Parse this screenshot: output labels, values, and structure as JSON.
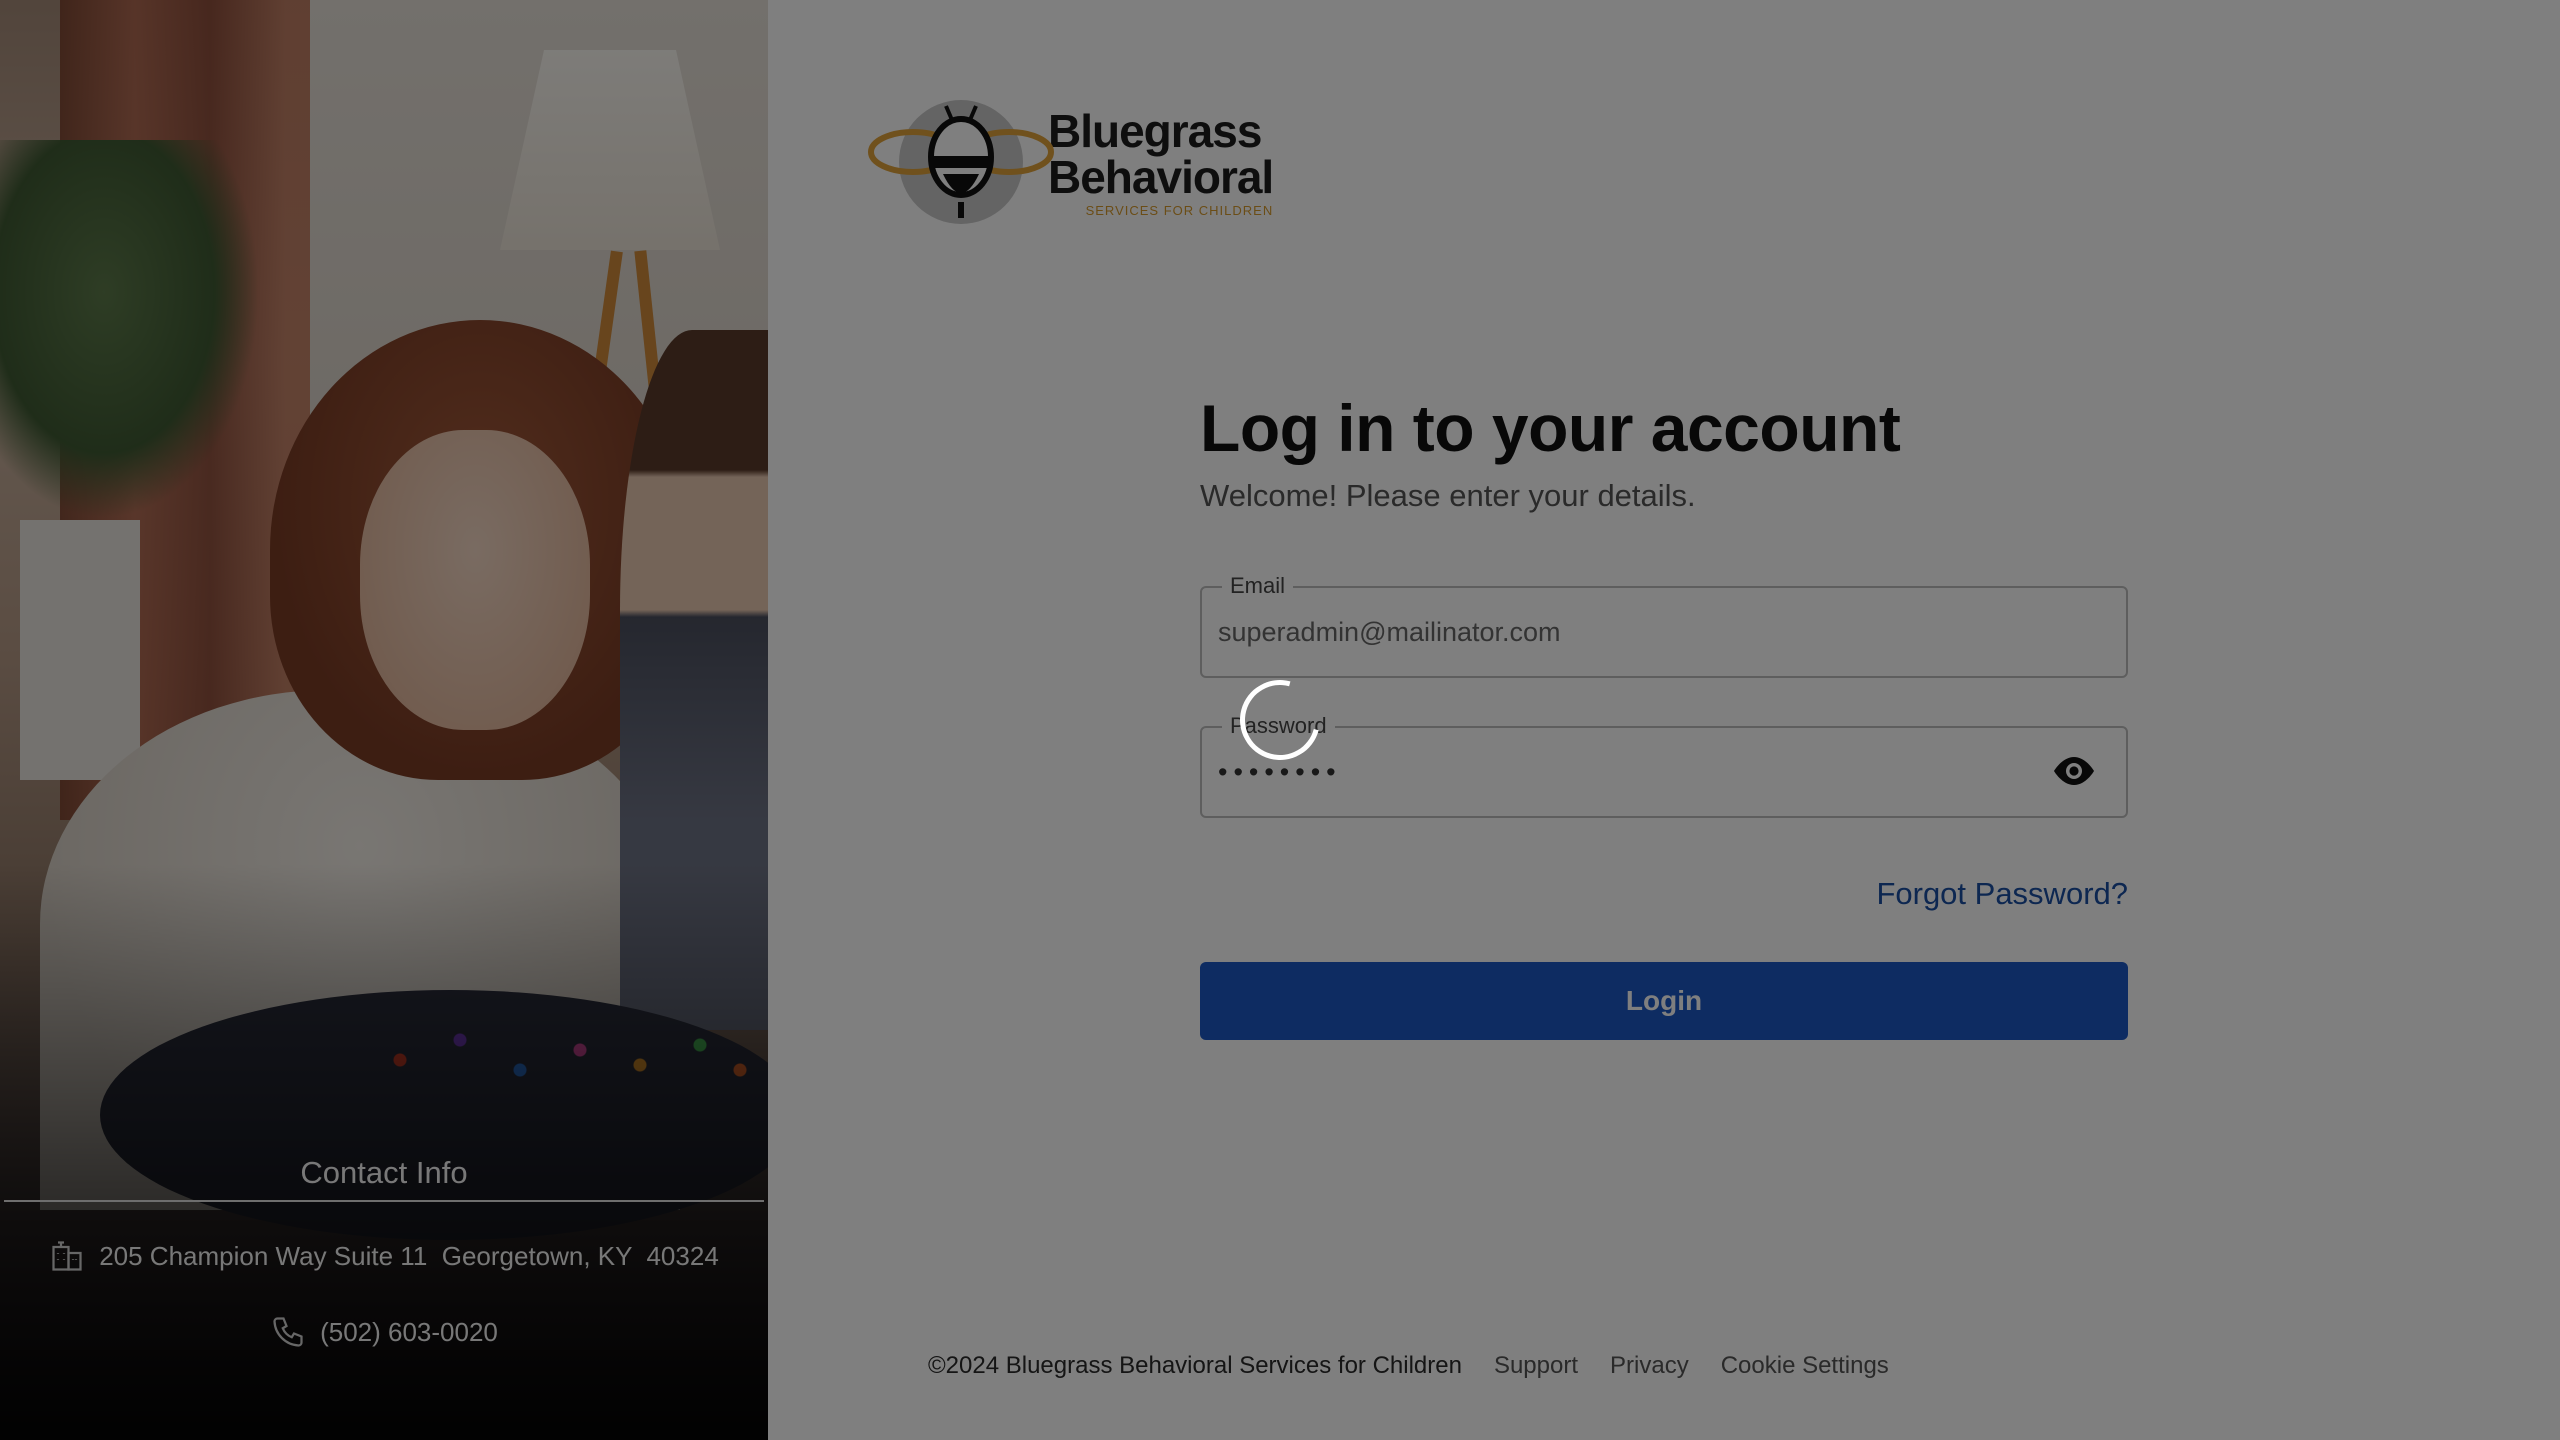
{
  "brand": {
    "name_line1": "Bluegrass",
    "name_line2": "Behavioral",
    "tagline": "SERVICES FOR CHILDREN",
    "accent_color": "#d79a2c"
  },
  "login": {
    "heading": "Log in to your account",
    "subheading": "Welcome! Please enter your details.",
    "email_label": "Email",
    "email_value": "superadmin@mailinator.com",
    "password_label": "Password",
    "password_value": "••••••••",
    "password_toggle_icon": "eye-icon",
    "forgot_link": "Forgot Password?",
    "login_button": "Login",
    "button_color": "#1d58c4",
    "link_color": "#1a4fa3"
  },
  "contact": {
    "title": "Contact Info",
    "address_icon": "building-icon",
    "address": "205 Champion Way Suite 11  Georgetown, KY  40324",
    "phone_icon": "phone-icon",
    "phone": "(502) 603-0020"
  },
  "footer": {
    "copyright": "©2024 Bluegrass Behavioral Services for Children",
    "links": [
      "Support",
      "Privacy",
      "Cookie Settings"
    ]
  },
  "state": {
    "loading": true,
    "loading_icon": "spinner-icon"
  }
}
